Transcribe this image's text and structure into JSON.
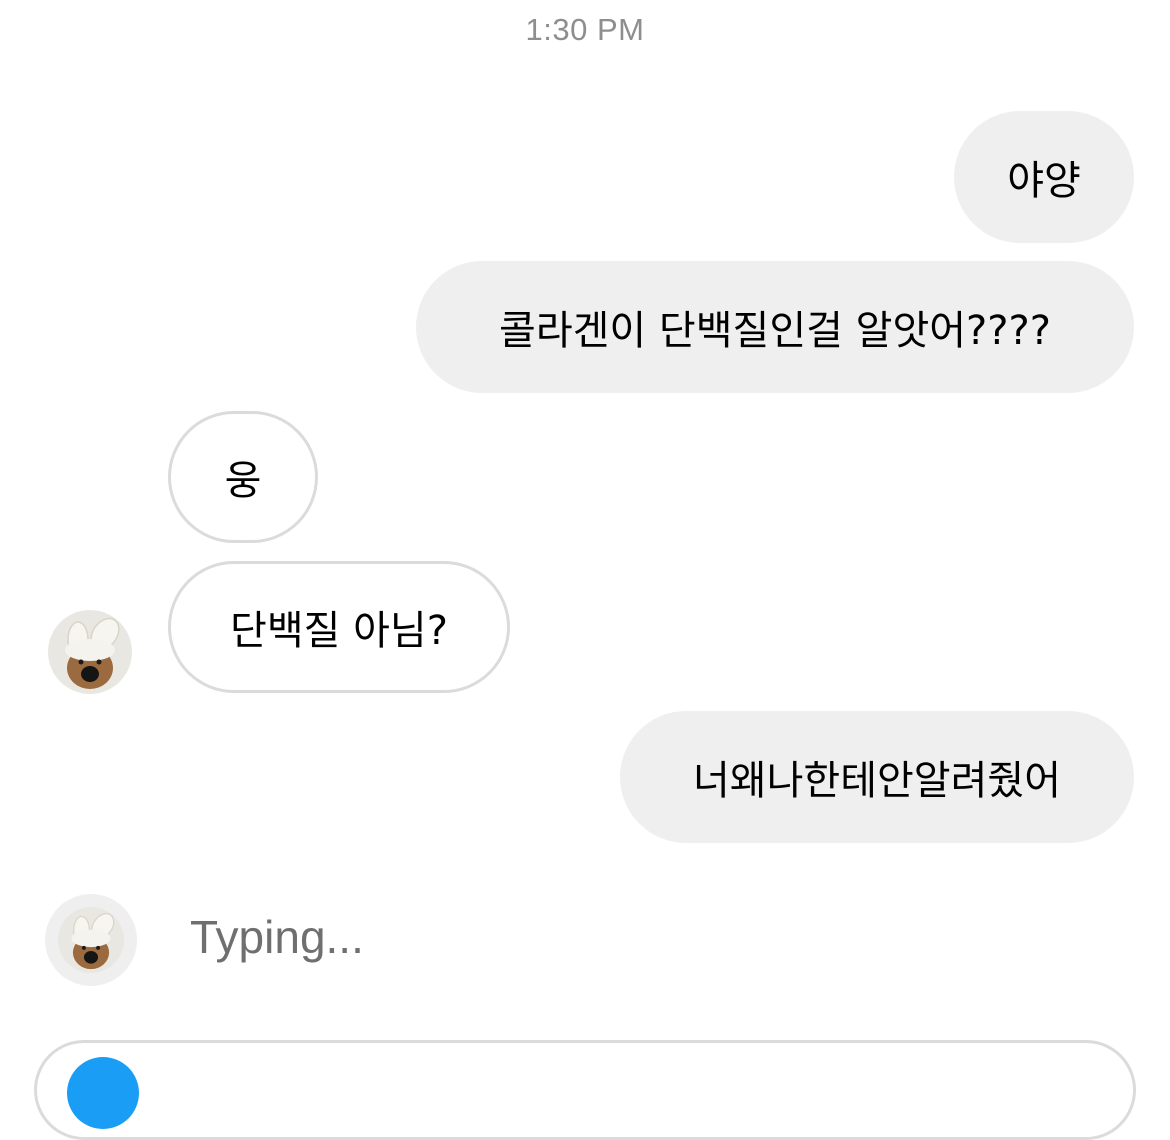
{
  "chat": {
    "timestamp": "1:30 PM",
    "messages": [
      {
        "direction": "outgoing",
        "text": "야양"
      },
      {
        "direction": "outgoing",
        "text": "콜라겐이 단백질인걸 알앗어????"
      },
      {
        "direction": "incoming",
        "text": "웅"
      },
      {
        "direction": "incoming",
        "text": "단백질 아님?"
      },
      {
        "direction": "outgoing",
        "text": "너왜나한테안알려줬어"
      }
    ],
    "typing_indicator": "Typing..."
  },
  "icons": {
    "avatar": "bear-bunny-ears-avatar",
    "camera": "camera-icon"
  },
  "colors": {
    "outgoing_bubble": "#efefef",
    "incoming_border": "#dbdbdb",
    "timestamp": "#8e8e8e",
    "camera_button": "#1a9ef5"
  }
}
